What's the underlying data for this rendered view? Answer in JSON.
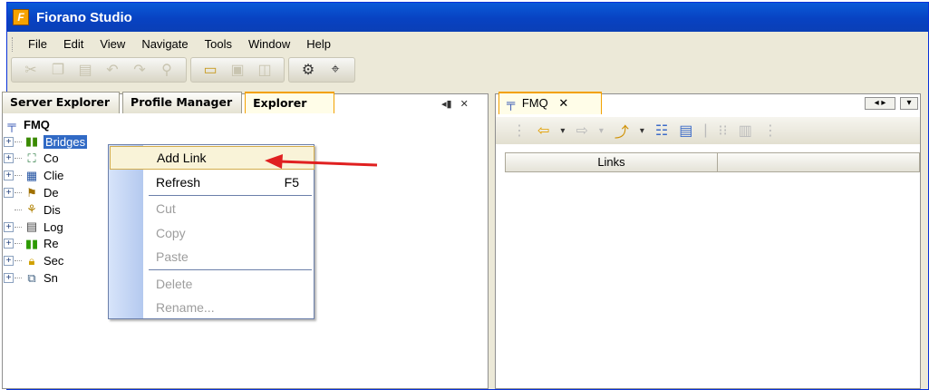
{
  "app": {
    "title": "Fiorano Studio",
    "logo_letter": "F"
  },
  "menu": [
    "File",
    "Edit",
    "View",
    "Navigate",
    "Tools",
    "Window",
    "Help"
  ],
  "left_tabs": [
    "Server Explorer",
    "Profile Manager",
    "Explorer"
  ],
  "tree": {
    "root": "FMQ",
    "items": [
      {
        "label": "Bridges",
        "icon": "bridge-icon"
      },
      {
        "label": "Co",
        "icon": "connection-icon"
      },
      {
        "label": "Clie",
        "icon": "client-icon"
      },
      {
        "label": "De",
        "icon": "destination-icon"
      },
      {
        "label": "Dis",
        "icon": "dispatcher-icon"
      },
      {
        "label": "Log",
        "icon": "log-icon"
      },
      {
        "label": "Re",
        "icon": "repository-icon"
      },
      {
        "label": "Sec",
        "icon": "security-icon"
      },
      {
        "label": "Sn",
        "icon": "snooper-icon"
      }
    ]
  },
  "context_menu": {
    "add_link": "Add Link",
    "refresh": "Refresh",
    "refresh_shortcut": "F5",
    "cut": "Cut",
    "copy": "Copy",
    "paste": "Paste",
    "delete": "Delete",
    "rename": "Rename..."
  },
  "right_panel": {
    "tab": "FMQ",
    "column_header": "Links"
  },
  "colors": {
    "title_bar": "#0842c2",
    "accent": "#f2a100",
    "arrow": "#e02020",
    "selection": "#316ac5"
  }
}
